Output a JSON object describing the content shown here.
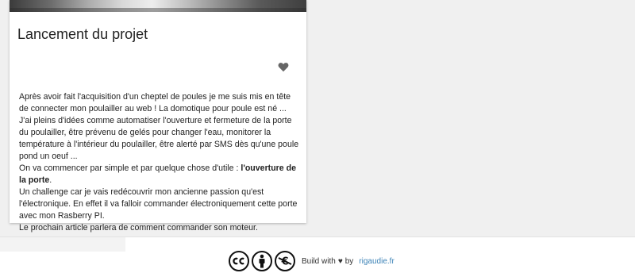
{
  "article": {
    "title": "Lancement du projet",
    "like_icon": "heart-icon",
    "paragraphs": [
      "Après avoir fait l'acquisition d'un cheptel de poules je me suis mis en tête de connecter mon poulailler au web ! La domotique pour poule est né ...",
      "J'ai pleins d'idées comme automatiser l'ouverture et fermeture de la porte du poulailler, être prévenu de gelés pour changer l'eau, monitorer la température à l'intérieur du poulailler, être alerté par SMS dès qu'une poule pond un oeuf ...",
      "On va commencer par simple et par quelque chose d'utile : ",
      "l'ouverture de la porte",
      ".",
      "Un challenge car je vais redécouvrir mon ancienne passion qu'est l'électronique. En effet il va falloir commander électroniquement cette porte avec mon Rasberry PI.",
      "Le prochain article parlera de comment commander son moteur."
    ]
  },
  "footer": {
    "license_icons": [
      "cc-icon",
      "by-attribution-icon",
      "non-commercial-icon"
    ],
    "build_prefix": "Build with",
    "heart": "♥",
    "build_by": "by",
    "site_link": "rigaudie.fr"
  },
  "colors": {
    "background": "#f0f0f0",
    "card": "#ffffff",
    "link": "#3b82b6"
  }
}
